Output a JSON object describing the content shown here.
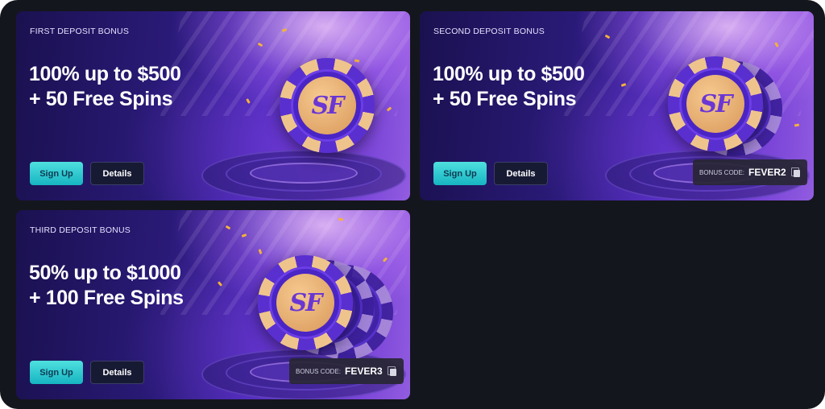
{
  "promotions": [
    {
      "label": "FIRST DEPOSIT BONUS",
      "headline_line1": "100% up to $500",
      "headline_line2": "+ 50 Free Spins",
      "signup_label": "Sign Up",
      "details_label": "Details",
      "chip_logo": "SF"
    },
    {
      "label": "SECOND DEPOSIT BONUS",
      "headline_line1": "100% up to $500",
      "headline_line2": "+ 50 Free Spins",
      "signup_label": "Sign Up",
      "details_label": "Details",
      "bonus_code_label": "BONUS CODE:",
      "bonus_code": "FEVER2",
      "chip_logo": "SF"
    },
    {
      "label": "THIRD DEPOSIT BONUS",
      "headline_line1": "50% up to $1000",
      "headline_line2": "+ 100 Free Spins",
      "signup_label": "Sign Up",
      "details_label": "Details",
      "bonus_code_label": "BONUS CODE:",
      "bonus_code": "FEVER3",
      "chip_logo": "SF"
    }
  ],
  "colors": {
    "page_background": "#14161d",
    "signup_button": "#2ccad0",
    "details_button": "#171a33",
    "chip_gold": "#efc48c",
    "chip_purple": "#5a2fd0"
  },
  "icons": {
    "copy": "copy-icon"
  }
}
